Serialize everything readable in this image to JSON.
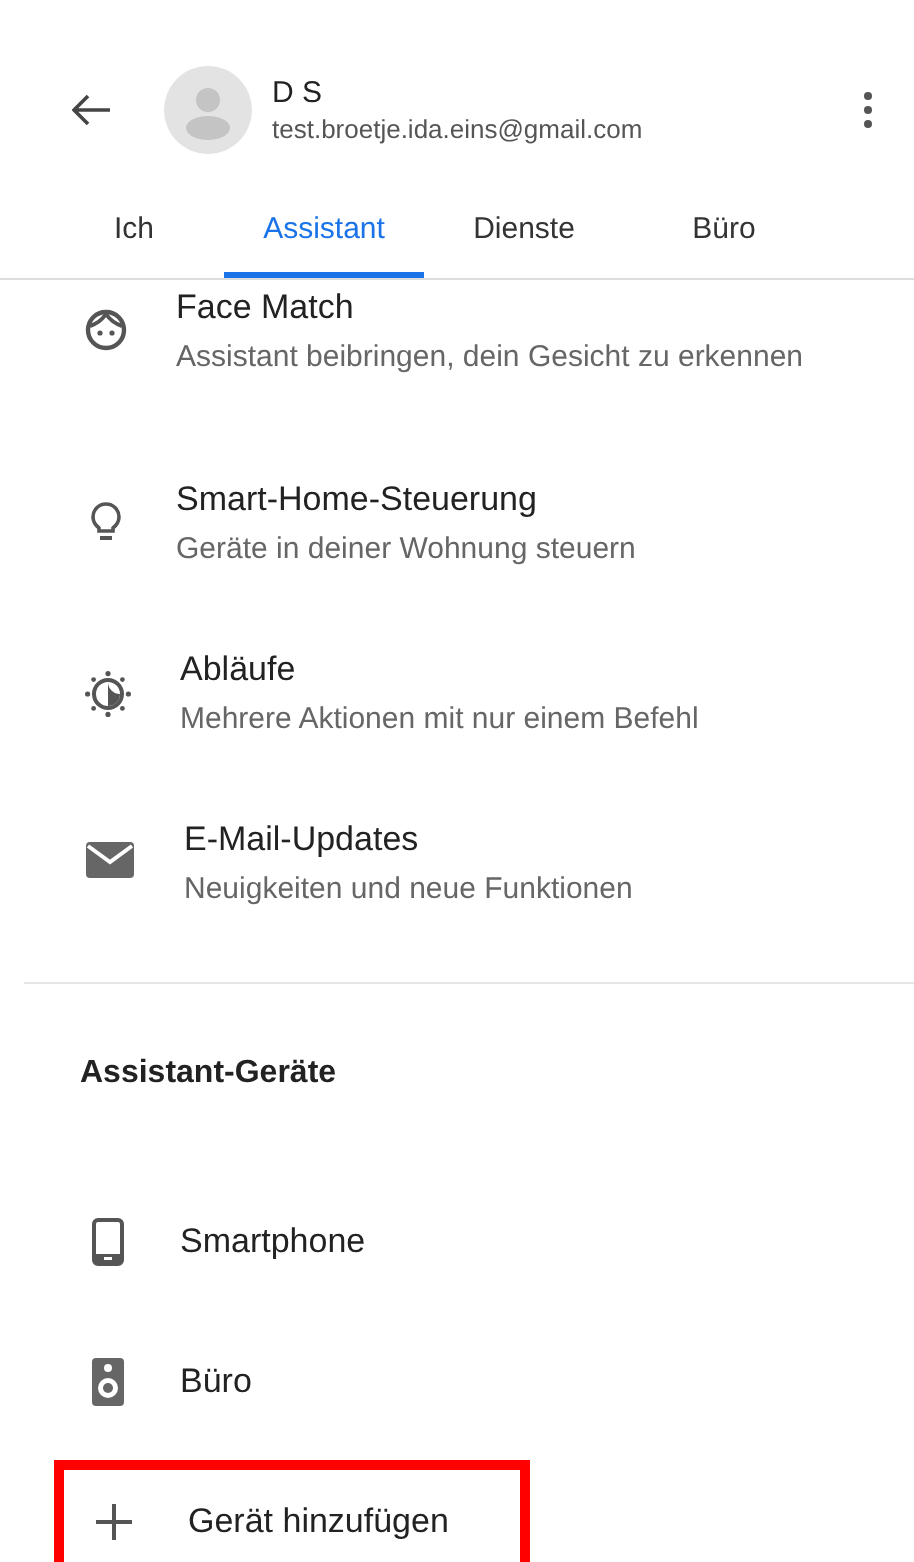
{
  "header": {
    "name": "D S",
    "email": "test.broetje.ida.eins@gmail.com"
  },
  "tabs": [
    {
      "label": "Ich",
      "selected": false
    },
    {
      "label": "Assistant",
      "selected": true
    },
    {
      "label": "Dienste",
      "selected": false
    },
    {
      "label": "Büro",
      "selected": false
    }
  ],
  "settings": [
    {
      "kind": "face",
      "title": "Face Match",
      "subtitle": "Assistant beibringen, dein Gesicht zu erkennen"
    },
    {
      "kind": "bulb",
      "title": "Smart-Home-Steuerung",
      "subtitle": "Geräte in deiner Wohnung steuern"
    },
    {
      "kind": "routine",
      "title": "Abläufe",
      "subtitle": "Mehrere Aktionen mit nur einem Befehl"
    },
    {
      "kind": "mail",
      "title": "E-Mail-Updates",
      "subtitle": "Neuigkeiten und neue Funktionen"
    }
  ],
  "devices_section": {
    "heading": "Assistant-Geräte",
    "items": [
      {
        "kind": "phone",
        "label": "Smartphone",
        "highlighted": false
      },
      {
        "kind": "speaker",
        "label": "Büro",
        "highlighted": false
      },
      {
        "kind": "add",
        "label": "Gerät hinzufügen",
        "highlighted": true
      }
    ]
  }
}
